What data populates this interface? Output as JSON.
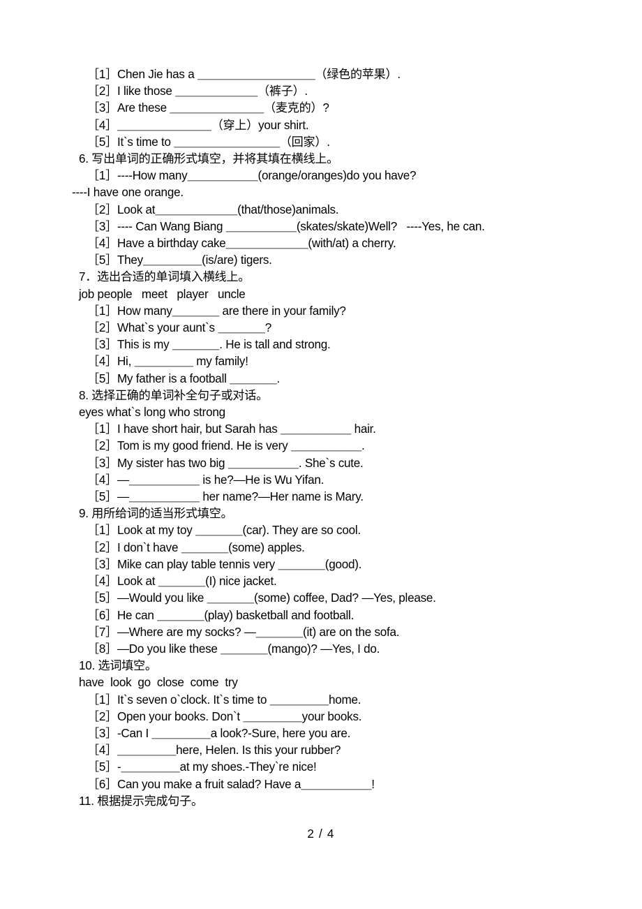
{
  "document": {
    "page_label": "2 / 4",
    "lines": [
      {
        "id": "l1",
        "kind": "item",
        "text": "［1］Chen Jie has a ＿＿＿＿＿＿＿＿＿＿（绿色的苹果）."
      },
      {
        "id": "l2",
        "kind": "item",
        "text": "［2］I like those ＿＿＿＿＿＿＿（裤子）."
      },
      {
        "id": "l3",
        "kind": "item",
        "text": "［3］Are these ＿＿＿＿＿＿＿＿（麦克的）?"
      },
      {
        "id": "l4",
        "kind": "item",
        "text": "［4］＿＿＿＿＿＿＿＿（穿上）your shirt."
      },
      {
        "id": "l5",
        "kind": "item",
        "text": "［5］It`s time to ＿＿＿＿＿＿＿＿＿（回家）."
      },
      {
        "id": "l6",
        "kind": "heading",
        "text": "6. 写出单词的正确形式填空，并将其填在横线上。"
      },
      {
        "id": "l7",
        "kind": "item",
        "text": "［1］----How many＿＿＿＿＿＿(orange/oranges)do you have?"
      },
      {
        "id": "l8",
        "kind": "flush",
        "text": "----I have one orange."
      },
      {
        "id": "l9",
        "kind": "item",
        "text": "［2］Look at＿＿＿＿＿＿＿(that/those)animals."
      },
      {
        "id": "l10",
        "kind": "item",
        "text": "［3］---- Can Wang Biang ＿＿＿＿＿＿(skates/skate)Well?   ----Yes, he can."
      },
      {
        "id": "l11",
        "kind": "item",
        "text": "［4］Have a birthday cake＿＿＿＿＿＿＿(with/at) a cherry."
      },
      {
        "id": "l12",
        "kind": "item",
        "text": "［5］They＿＿＿＿＿(is/are) tigers."
      },
      {
        "id": "l13",
        "kind": "heading",
        "text": "7．选出合适的单词填入横线上。"
      },
      {
        "id": "l14",
        "kind": "wordbank",
        "text": "job people   meet   player   uncle"
      },
      {
        "id": "l15",
        "kind": "item",
        "text": "［1］How many＿＿＿＿ are there in your family?"
      },
      {
        "id": "l16",
        "kind": "item",
        "text": "［2］What`s your aunt`s ＿＿＿＿?"
      },
      {
        "id": "l17",
        "kind": "item",
        "text": "［3］This is my ＿＿＿＿. He is tall and strong."
      },
      {
        "id": "l18",
        "kind": "item",
        "text": "［4］Hi, ＿＿＿＿＿ my family!"
      },
      {
        "id": "l19",
        "kind": "item",
        "text": "［5］My father is a football ＿＿＿＿."
      },
      {
        "id": "l20",
        "kind": "heading",
        "text": "8. 选择正确的单词补全句子或对话。"
      },
      {
        "id": "l21",
        "kind": "wordbank",
        "text": "eyes what`s long who strong"
      },
      {
        "id": "l22",
        "kind": "item",
        "text": "［1］I have short hair, but Sarah has ＿＿＿＿＿＿ hair."
      },
      {
        "id": "l23",
        "kind": "item",
        "text": "［2］Tom is my good friend. He is very ＿＿＿＿＿＿."
      },
      {
        "id": "l24",
        "kind": "item",
        "text": "［3］My sister has two big ＿＿＿＿＿＿. She`s cute."
      },
      {
        "id": "l25",
        "kind": "item",
        "text": "［4］—＿＿＿＿＿＿ is he?—He is Wu Yifan."
      },
      {
        "id": "l26",
        "kind": "item",
        "text": "［5］—＿＿＿＿＿＿ her name?—Her name is Mary."
      },
      {
        "id": "l27",
        "kind": "heading",
        "text": "9. 用所给词的适当形式填空。"
      },
      {
        "id": "l28",
        "kind": "item",
        "text": "［1］Look at my toy ＿＿＿＿(car). They are so cool."
      },
      {
        "id": "l29",
        "kind": "item",
        "text": "［2］I don`t have ＿＿＿＿(some) apples."
      },
      {
        "id": "l30",
        "kind": "item",
        "text": "［3］Mike can play table tennis very ＿＿＿＿(good)."
      },
      {
        "id": "l31",
        "kind": "item",
        "text": "［4］Look at ＿＿＿＿(I) nice jacket."
      },
      {
        "id": "l32",
        "kind": "item",
        "text": "［5］—Would you like ＿＿＿＿(some) coffee, Dad? —Yes, please."
      },
      {
        "id": "l33",
        "kind": "item",
        "text": "［6］He can ＿＿＿＿(play) basketball and football."
      },
      {
        "id": "l34",
        "kind": "item",
        "text": "［7］—Where are my socks? —＿＿＿＿(it) are on the sofa."
      },
      {
        "id": "l35",
        "kind": "item",
        "text": "［8］—Do you like these ＿＿＿＿(mango)? —Yes, I do."
      },
      {
        "id": "l36",
        "kind": "heading",
        "text": "10. 选词填空。"
      },
      {
        "id": "l37",
        "kind": "wordbank",
        "text": "have  look  go  close  come  try"
      },
      {
        "id": "l38",
        "kind": "item",
        "text": "［1］It`s seven o`clock. It`s time to ＿＿＿＿＿home."
      },
      {
        "id": "l39",
        "kind": "item",
        "text": "［2］Open your books. Don`t ＿＿＿＿＿your books."
      },
      {
        "id": "l40",
        "kind": "item",
        "text": "［3］-Can I ＿＿＿＿＿a look?-Sure, here you are."
      },
      {
        "id": "l41",
        "kind": "item",
        "text": "［4］＿＿＿＿＿here, Helen. Is this your rubber?"
      },
      {
        "id": "l42",
        "kind": "item",
        "text": "［5］-＿＿＿＿＿at my shoes.-They`re nice!"
      },
      {
        "id": "l43",
        "kind": "item",
        "text": "［6］Can you make a fruit salad? Have a＿＿＿＿＿＿!"
      },
      {
        "id": "l44",
        "kind": "heading",
        "text": "11. 根据提示完成句子。"
      }
    ]
  }
}
